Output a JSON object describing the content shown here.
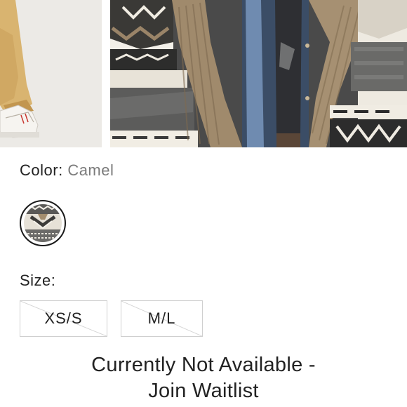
{
  "gallery": {
    "images": [
      {
        "name": "model-pants-shoes"
      },
      {
        "name": "cardigan-closeup"
      }
    ]
  },
  "color": {
    "label": "Color:",
    "selected": "Camel"
  },
  "swatches": [
    {
      "name": "camel",
      "selected": true
    }
  ],
  "size": {
    "label": "Size:",
    "options": [
      {
        "label": "XS/S",
        "available": false
      },
      {
        "label": "M/L",
        "available": false
      }
    ]
  },
  "availability": {
    "line1": "Currently Not Available -",
    "line2": "Join Waitlist"
  },
  "colors": {
    "text": "#222222",
    "muted": "#7a7a7a",
    "border": "#cfcfcf"
  }
}
